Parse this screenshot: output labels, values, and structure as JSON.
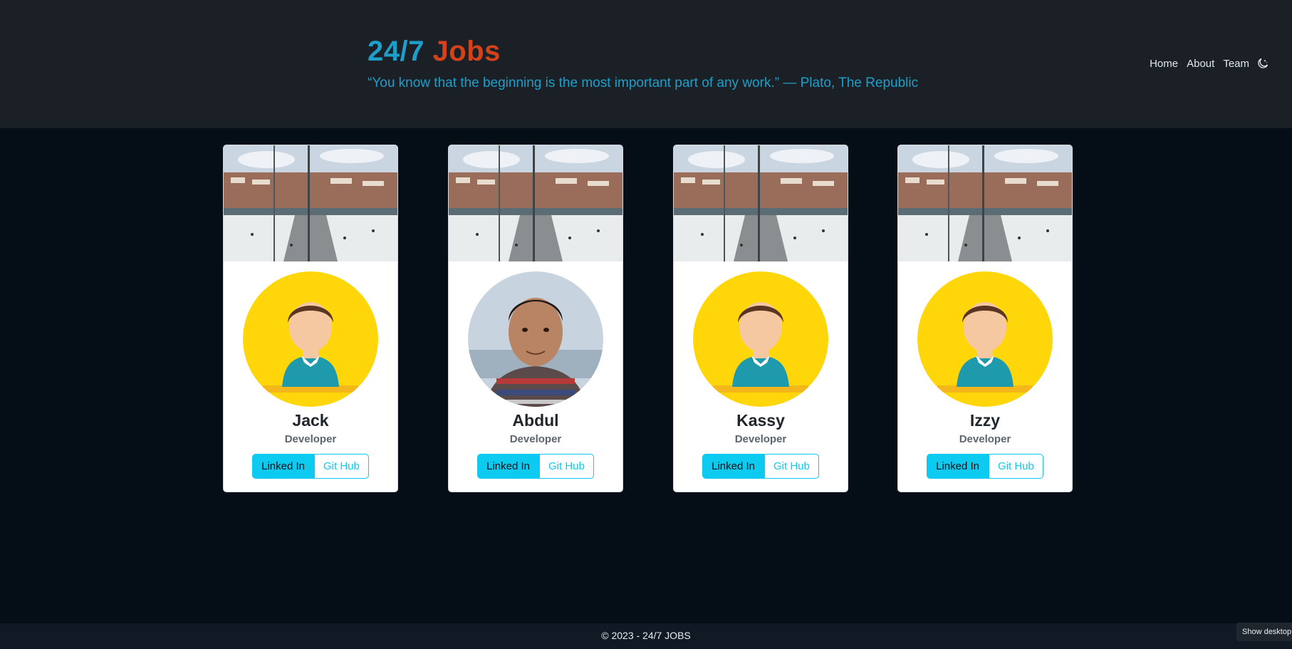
{
  "header": {
    "brand_part1": "24/7",
    "brand_part2": "Jobs",
    "quote": "“You know that the beginning is the most important part of any work.” — Plato, The Republic",
    "nav": [
      "Home",
      "About",
      "Team"
    ],
    "theme_toggle_icon": "moon-stars-icon"
  },
  "team": [
    {
      "name": "Jack",
      "role": "Developer",
      "linkedin_label": "Linked In",
      "github_label": "Git Hub",
      "avatar": "cartoon-avatar"
    },
    {
      "name": "Abdul",
      "role": "Developer",
      "linkedin_label": "Linked In",
      "github_label": "Git Hub",
      "avatar": "photo-avatar"
    },
    {
      "name": "Kassy",
      "role": "Developer",
      "linkedin_label": "Linked In",
      "github_label": "Git Hub",
      "avatar": "cartoon-avatar"
    },
    {
      "name": "Izzy",
      "role": "Developer",
      "linkedin_label": "Linked In",
      "github_label": "Git Hub",
      "avatar": "cartoon-avatar"
    }
  ],
  "footer": {
    "copyright": "© 2023 - 24/7 JOBS"
  },
  "system": {
    "show_desktop": "Show desktop"
  },
  "colors": {
    "brand_blue": "#1e9fc9",
    "brand_orange": "#d2431a",
    "info": "#0dcaf0",
    "avatar_yellow": "#ffd60a"
  }
}
